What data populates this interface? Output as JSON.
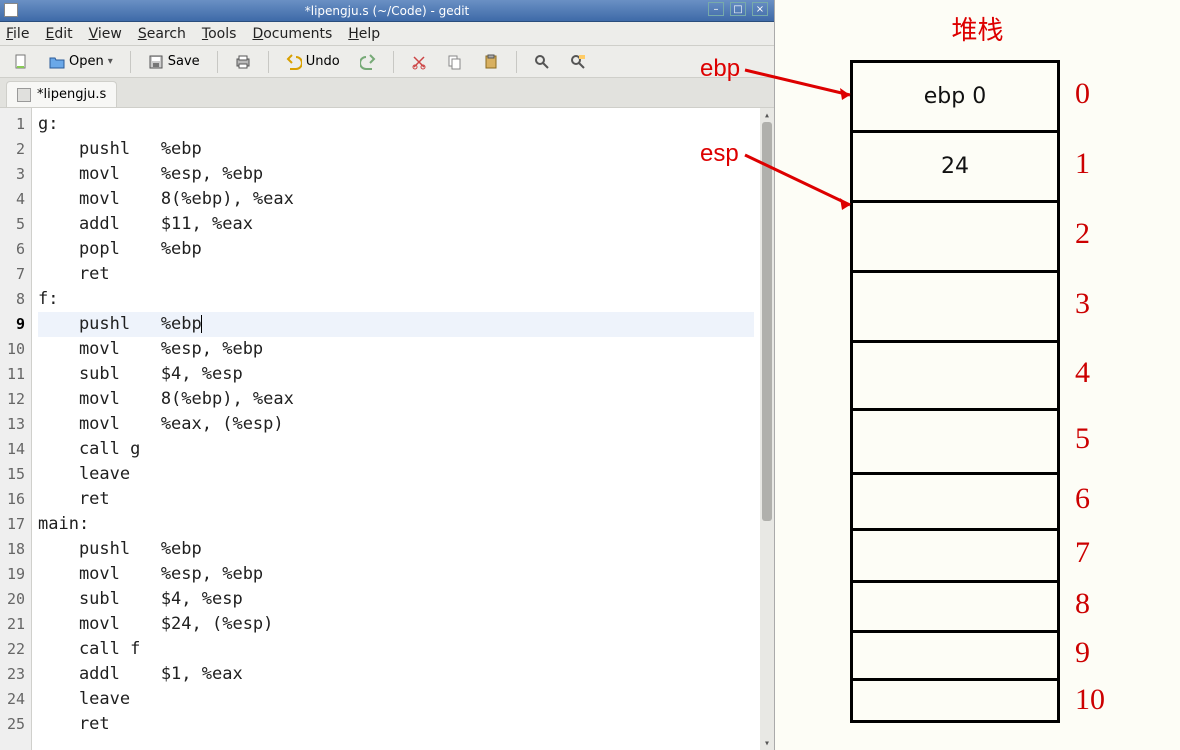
{
  "window": {
    "title": "*lipengju.s (~/Code) - gedit"
  },
  "menubar": {
    "file": "File",
    "edit": "Edit",
    "view": "View",
    "search": "Search",
    "tools": "Tools",
    "documents": "Documents",
    "help": "Help"
  },
  "toolbar": {
    "new_tip": "New",
    "open_label": "Open",
    "save_label": "Save",
    "print_tip": "Print",
    "undo_label": "Undo",
    "redo_tip": "Redo",
    "cut_tip": "Cut",
    "copy_tip": "Copy",
    "paste_tip": "Paste",
    "find_tip": "Find",
    "replace_tip": "Find and Replace"
  },
  "tab": {
    "label": "*lipengju.s"
  },
  "code": {
    "lines": [
      {
        "n": 1,
        "text": "g:"
      },
      {
        "n": 2,
        "text": "    pushl   %ebp"
      },
      {
        "n": 3,
        "text": "    movl    %esp, %ebp"
      },
      {
        "n": 4,
        "text": "    movl    8(%ebp), %eax"
      },
      {
        "n": 5,
        "text": "    addl    $11, %eax"
      },
      {
        "n": 6,
        "text": "    popl    %ebp"
      },
      {
        "n": 7,
        "text": "    ret"
      },
      {
        "n": 8,
        "text": "f:"
      },
      {
        "n": 9,
        "text": "    pushl   %ebp"
      },
      {
        "n": 10,
        "text": "    movl    %esp, %ebp"
      },
      {
        "n": 11,
        "text": "    subl    $4, %esp"
      },
      {
        "n": 12,
        "text": "    movl    8(%ebp), %eax"
      },
      {
        "n": 13,
        "text": "    movl    %eax, (%esp)"
      },
      {
        "n": 14,
        "text": "    call g"
      },
      {
        "n": 15,
        "text": "    leave"
      },
      {
        "n": 16,
        "text": "    ret"
      },
      {
        "n": 17,
        "text": "main:"
      },
      {
        "n": 18,
        "text": "    pushl   %ebp"
      },
      {
        "n": 19,
        "text": "    movl    %esp, %ebp"
      },
      {
        "n": 20,
        "text": "    subl    $4, %esp"
      },
      {
        "n": 21,
        "text": "    movl    $24, (%esp)"
      },
      {
        "n": 22,
        "text": "    call f"
      },
      {
        "n": 23,
        "text": "    addl    $1, %eax"
      },
      {
        "n": 24,
        "text": "    leave"
      },
      {
        "n": 25,
        "text": "    ret"
      }
    ],
    "current_line": 9
  },
  "diagram": {
    "title": "堆栈",
    "ebp_label": "ebp",
    "esp_label": "esp",
    "rows": [
      {
        "content": "ebp 0",
        "h": 70,
        "index": "0"
      },
      {
        "content": "24",
        "h": 70,
        "index": "1"
      },
      {
        "content": "",
        "h": 70,
        "index": "2"
      },
      {
        "content": "",
        "h": 70,
        "index": "3"
      },
      {
        "content": "",
        "h": 68,
        "index": "4"
      },
      {
        "content": "",
        "h": 64,
        "index": "5"
      },
      {
        "content": "",
        "h": 56,
        "index": "6"
      },
      {
        "content": "",
        "h": 52,
        "index": "7"
      },
      {
        "content": "",
        "h": 50,
        "index": "8"
      },
      {
        "content": "",
        "h": 48,
        "index": "9"
      },
      {
        "content": "",
        "h": 45,
        "index": "10"
      }
    ]
  }
}
